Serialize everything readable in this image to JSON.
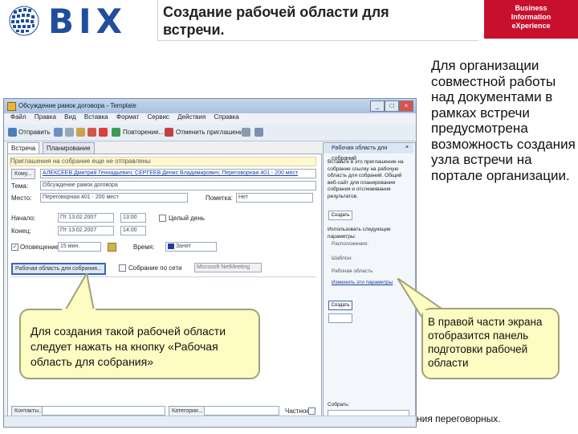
{
  "header": {
    "logo_text": "BIX",
    "title": "Создание рабочей области для встречи.",
    "badge_lines": [
      "Business",
      "Information",
      "eXperience"
    ]
  },
  "description": "Для организации совместной работы над документами в рамках встречи предусмотрена возможность создания узла встречи на портале организации.",
  "outlook": {
    "window_title": "Обсуждение рамок договора - Template",
    "menu": [
      "Файл",
      "Правка",
      "Вид",
      "Вставка",
      "Формат",
      "Сервис",
      "Действия",
      "Справка"
    ],
    "toolbar": {
      "send": "Отправить",
      "recurrence": "Повторение...",
      "cancel": "Отменить приглашение"
    },
    "tabs": [
      "Встреча",
      "Планирование"
    ],
    "info_text": "Приглашения на собрание еще не отправлены",
    "fields": {
      "to_label": "Кому...",
      "to_value": "АЛЕКСЕЕВ Дмитрий Геннадьевич; СЕРГЕЕВ Денис Владимирович; Переговорная 401 - 200 мест",
      "subject_label": "Тема:",
      "subject_value": "Обсуждение рамок договора",
      "location_label": "Место:",
      "location_value": "Переговорная 401 - 200 мест",
      "label_label": "Пометка:",
      "label_value": "Нет",
      "start_label": "Начало:",
      "start_date": "Пт 13.02.2007",
      "start_time": "13:00",
      "allday_label": "Целый день",
      "end_label": "Конец:",
      "end_date": "Пт 13.02.2007",
      "end_time": "14:00",
      "reminder_label": "Оповещение:",
      "reminder_value": "15 мин.",
      "showas_label": "Время:",
      "showas_value": "Занят",
      "workspace_button": "Рабочая область для собрания...",
      "online_label": "Собрание по сети",
      "online_value": "Microsoft NetMeeting",
      "contacts_button": "Контакты...",
      "categories_button": "Категории...",
      "private_label": "Частное"
    },
    "pane": {
      "title": "Рабочая область для собраний",
      "intro": "Вставьте в это приглашение на собрание ссылку на рабочую область для собраний. Общий веб-сайт для планирования собрания и отслеживания результатов.",
      "create_button": "Создать",
      "options_title": "Использовать следующие параметры:",
      "options": [
        "Расположение:",
        "Шаблон:",
        "Рабочая область"
      ],
      "options_link": "Изменить эти параметры",
      "ok_button": "Создать",
      "also_text": "Собрать:"
    }
  },
  "callouts": {
    "left": "Для создания такой рабочей области следует нажать на кнопку «Рабочая область для собрания»",
    "right": "В правой части экрана отобразится панель подготовки рабочей области"
  },
  "footer_fragment": "ния переговорных."
}
